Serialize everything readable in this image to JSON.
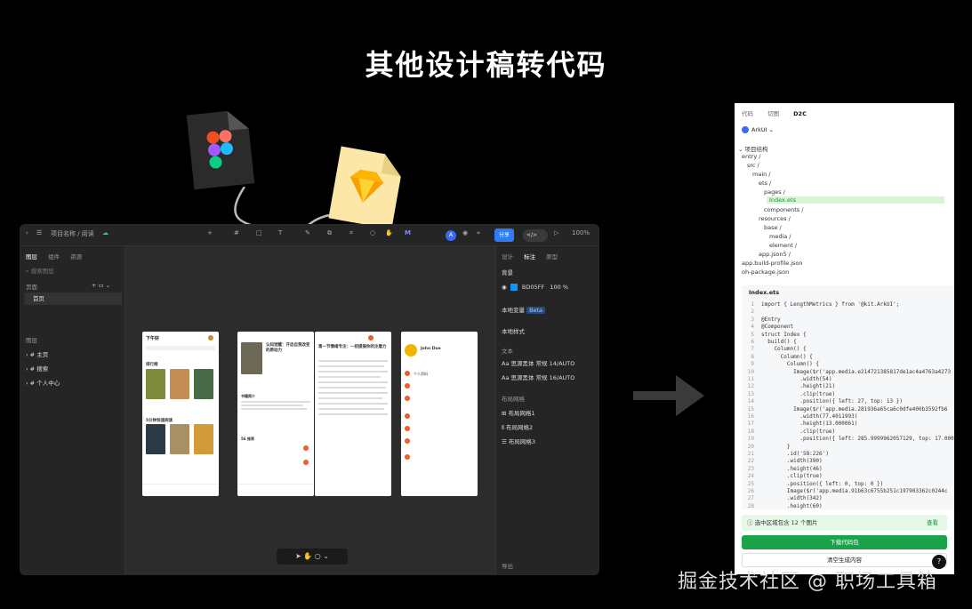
{
  "slide": {
    "title": "其他设计稿转代码"
  },
  "editor": {
    "breadcrumb": "项目名称 / 阅读 ",
    "zoom": "100% ",
    "share_label": "分享",
    "avatar_letter": "A",
    "left_panel": {
      "tabs": [
        "图层",
        "组件",
        "资源"
      ],
      "search_placeholder": "搜索图层",
      "pages_label": "页面",
      "page_item": "首页",
      "layers_label": "图层",
      "layers": [
        "主页",
        "搜索",
        "个人中心"
      ]
    },
    "right_panel": {
      "tabs": [
        "设计",
        "标注",
        "原型"
      ],
      "bg_label": "背景",
      "bg_color": "BD05FF",
      "bg_opacity": "100",
      "bg_opacity_unit": "%",
      "local_vars_label": "本地变量",
      "beta": "Beta",
      "local_styles_label": "本地样式",
      "text_label": "文本",
      "text_styles": [
        "Aa 思源黑体 常规 14/AUTO",
        "Aa 思源黑体 常规 16/AUTO"
      ],
      "grid_label": "布局网格",
      "grids": [
        "布局网格1",
        "布局网格2",
        "布局网格3"
      ],
      "export_label": "导出"
    },
    "phones": [
      {
        "title": "下午好",
        "sub1": "排行榜",
        "sub2": "5分钟快速阅读"
      },
      {
        "title": "认知觉醒：开启自我改变的原动力",
        "sub1": "书籍简介",
        "sub2": "56 推荐"
      },
      {
        "title": "第一节情绪专注：一招提振你的注意力",
        "sub1": "",
        "sub2": ""
      },
      {
        "title": "John Doe",
        "sub1": "个人资料",
        "sub2": ""
      }
    ]
  },
  "d2c": {
    "tabs": [
      "代码",
      "切图",
      "D2C"
    ],
    "framework": "ArkUI",
    "tree_title": "项目结构",
    "tree": [
      "entry /",
      "src /",
      "main /",
      "ets /",
      "pages /",
      "Index.ets",
      "components /",
      "resources /",
      "base /",
      "media /",
      "element /",
      "app.json5 /",
      "app.build-profile.json",
      "oh-package.json"
    ],
    "selected_file": "Index.ets",
    "code_file": "Index.ets",
    "code": [
      "import { LengthMetrics } from '@kit.ArkUI';",
      "",
      "@Entry",
      "@Component",
      "struct Index {",
      "  build() {",
      "    Column() {",
      "      Column() {",
      "        Column() {",
      "          Image($r('app.media.e214721385817de1ac4a4763a4273",
      "            .width(54)",
      "            .height(21)",
      "            .clip(true)",
      "            .position({ left: 27, top: 13 })",
      "          Image($r('app.media.281936a65ca6c0dfe400b3592fb6",
      "            .width(77.4011993)",
      "            .height(13.000061)",
      "            .clip(true)",
      "            .position({ left: 285.9999962057129, top: 17.0000",
      "        }",
      "        .id('58:226')",
      "        .width(390)",
      "        .height(46)",
      "        .clip(true)",
      "        .position({ left: 0, top: 0 })",
      "        Image($r('app.media.91b63c6755b251c197903362c0244c",
      "        .width(342)",
      "        .height(60)"
    ],
    "code_line_numbers": [
      "1",
      "2",
      "3",
      "4",
      "5",
      "6",
      "7",
      "8",
      "9",
      "10",
      "11",
      "12",
      "13",
      "14",
      "15",
      "16",
      "17",
      "18",
      "19",
      "20",
      "21",
      "22",
      "23",
      "24",
      "25",
      "26",
      "27",
      "28"
    ],
    "notice": "选中区域包含 12 个图片",
    "notice_view": "查看",
    "download_label": "下载代码包",
    "clear_label": "清空生成内容",
    "help": "?"
  },
  "watermark": "掘金技术社区 @ 职场工具箱",
  "colors": {
    "share": "#2f7cf6",
    "download": "#1aa34a",
    "selected_file": "#d8f5d8",
    "swatch": "#0d95ff"
  }
}
